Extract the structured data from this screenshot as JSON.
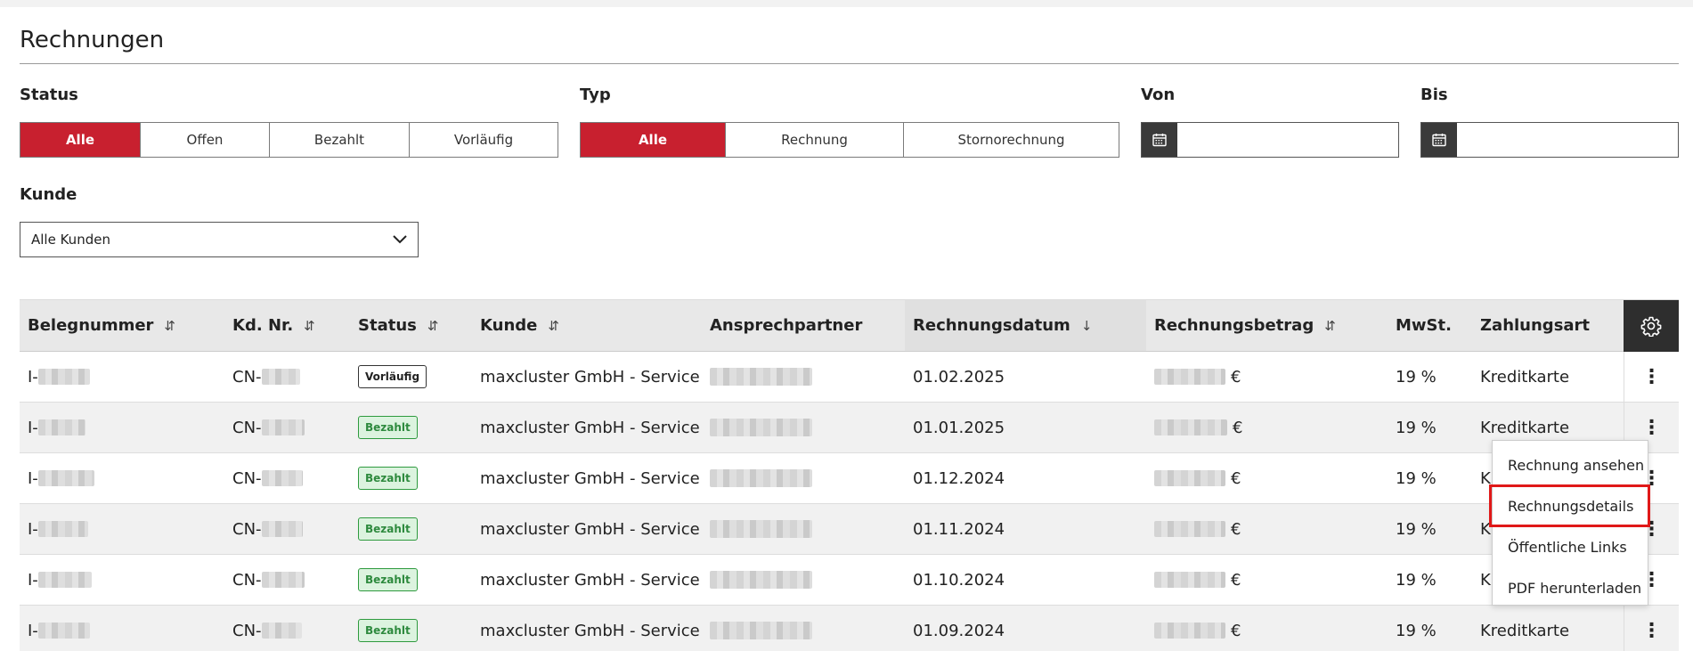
{
  "page_title": "Rechnungen",
  "filters": {
    "status": {
      "label": "Status",
      "options": [
        "Alle",
        "Offen",
        "Bezahlt",
        "Vorläufig"
      ],
      "active": "Alle"
    },
    "typ": {
      "label": "Typ",
      "options": [
        "Alle",
        "Rechnung",
        "Stornorechnung"
      ],
      "active": "Alle"
    },
    "von": {
      "label": "Von",
      "value": ""
    },
    "bis": {
      "label": "Bis",
      "value": ""
    },
    "kunde": {
      "label": "Kunde",
      "selected": "Alle Kunden"
    }
  },
  "table": {
    "columns": [
      "Belegnummer",
      "Kd. Nr.",
      "Status",
      "Kunde",
      "Ansprechpartner",
      "Rechnungsdatum",
      "Rechnungsbetrag",
      "MwSt.",
      "Zahlungsart"
    ],
    "rows": [
      {
        "beleg": "I-",
        "kd": "CN-",
        "status": "Vorläufig",
        "kunde": "maxcluster GmbH - Service",
        "datum": "01.02.2025",
        "currency": "€",
        "mwst": "19 %",
        "zahlung": "Kreditkarte"
      },
      {
        "beleg": "I-",
        "kd": "CN-",
        "status": "Bezahlt",
        "kunde": "maxcluster GmbH - Service",
        "datum": "01.01.2025",
        "currency": "€",
        "mwst": "19 %",
        "zahlung": "Kreditkarte"
      },
      {
        "beleg": "I-",
        "kd": "CN-",
        "status": "Bezahlt",
        "kunde": "maxcluster GmbH - Service",
        "datum": "01.12.2024",
        "currency": "€",
        "mwst": "19 %",
        "zahlung": "K"
      },
      {
        "beleg": "I-",
        "kd": "CN-",
        "status": "Bezahlt",
        "kunde": "maxcluster GmbH - Service",
        "datum": "01.11.2024",
        "currency": "€",
        "mwst": "19 %",
        "zahlung": "K"
      },
      {
        "beleg": "I-",
        "kd": "CN-",
        "status": "Bezahlt",
        "kunde": "maxcluster GmbH - Service",
        "datum": "01.10.2024",
        "currency": "€",
        "mwst": "19 %",
        "zahlung": "K"
      },
      {
        "beleg": "I-",
        "kd": "CN-",
        "status": "Bezahlt",
        "kunde": "maxcluster GmbH - Service",
        "datum": "01.09.2024",
        "currency": "€",
        "mwst": "19 %",
        "zahlung": "Kreditkarte"
      }
    ]
  },
  "context_menu": {
    "items": [
      "Rechnung ansehen",
      "Rechnungsdetails",
      "Öffentliche Links",
      "PDF herunterladen"
    ],
    "highlighted": "Rechnungsdetails"
  },
  "colors": {
    "accent": "#c8202f",
    "paid_green": "#2e8a3e",
    "dark": "#2e2e2e"
  },
  "icons": {
    "calendar": "calendar-icon",
    "gear": "gear-icon",
    "kebab": "kebab-menu-icon",
    "chevron": "chevron-down-icon",
    "sort": "sort-icon"
  }
}
